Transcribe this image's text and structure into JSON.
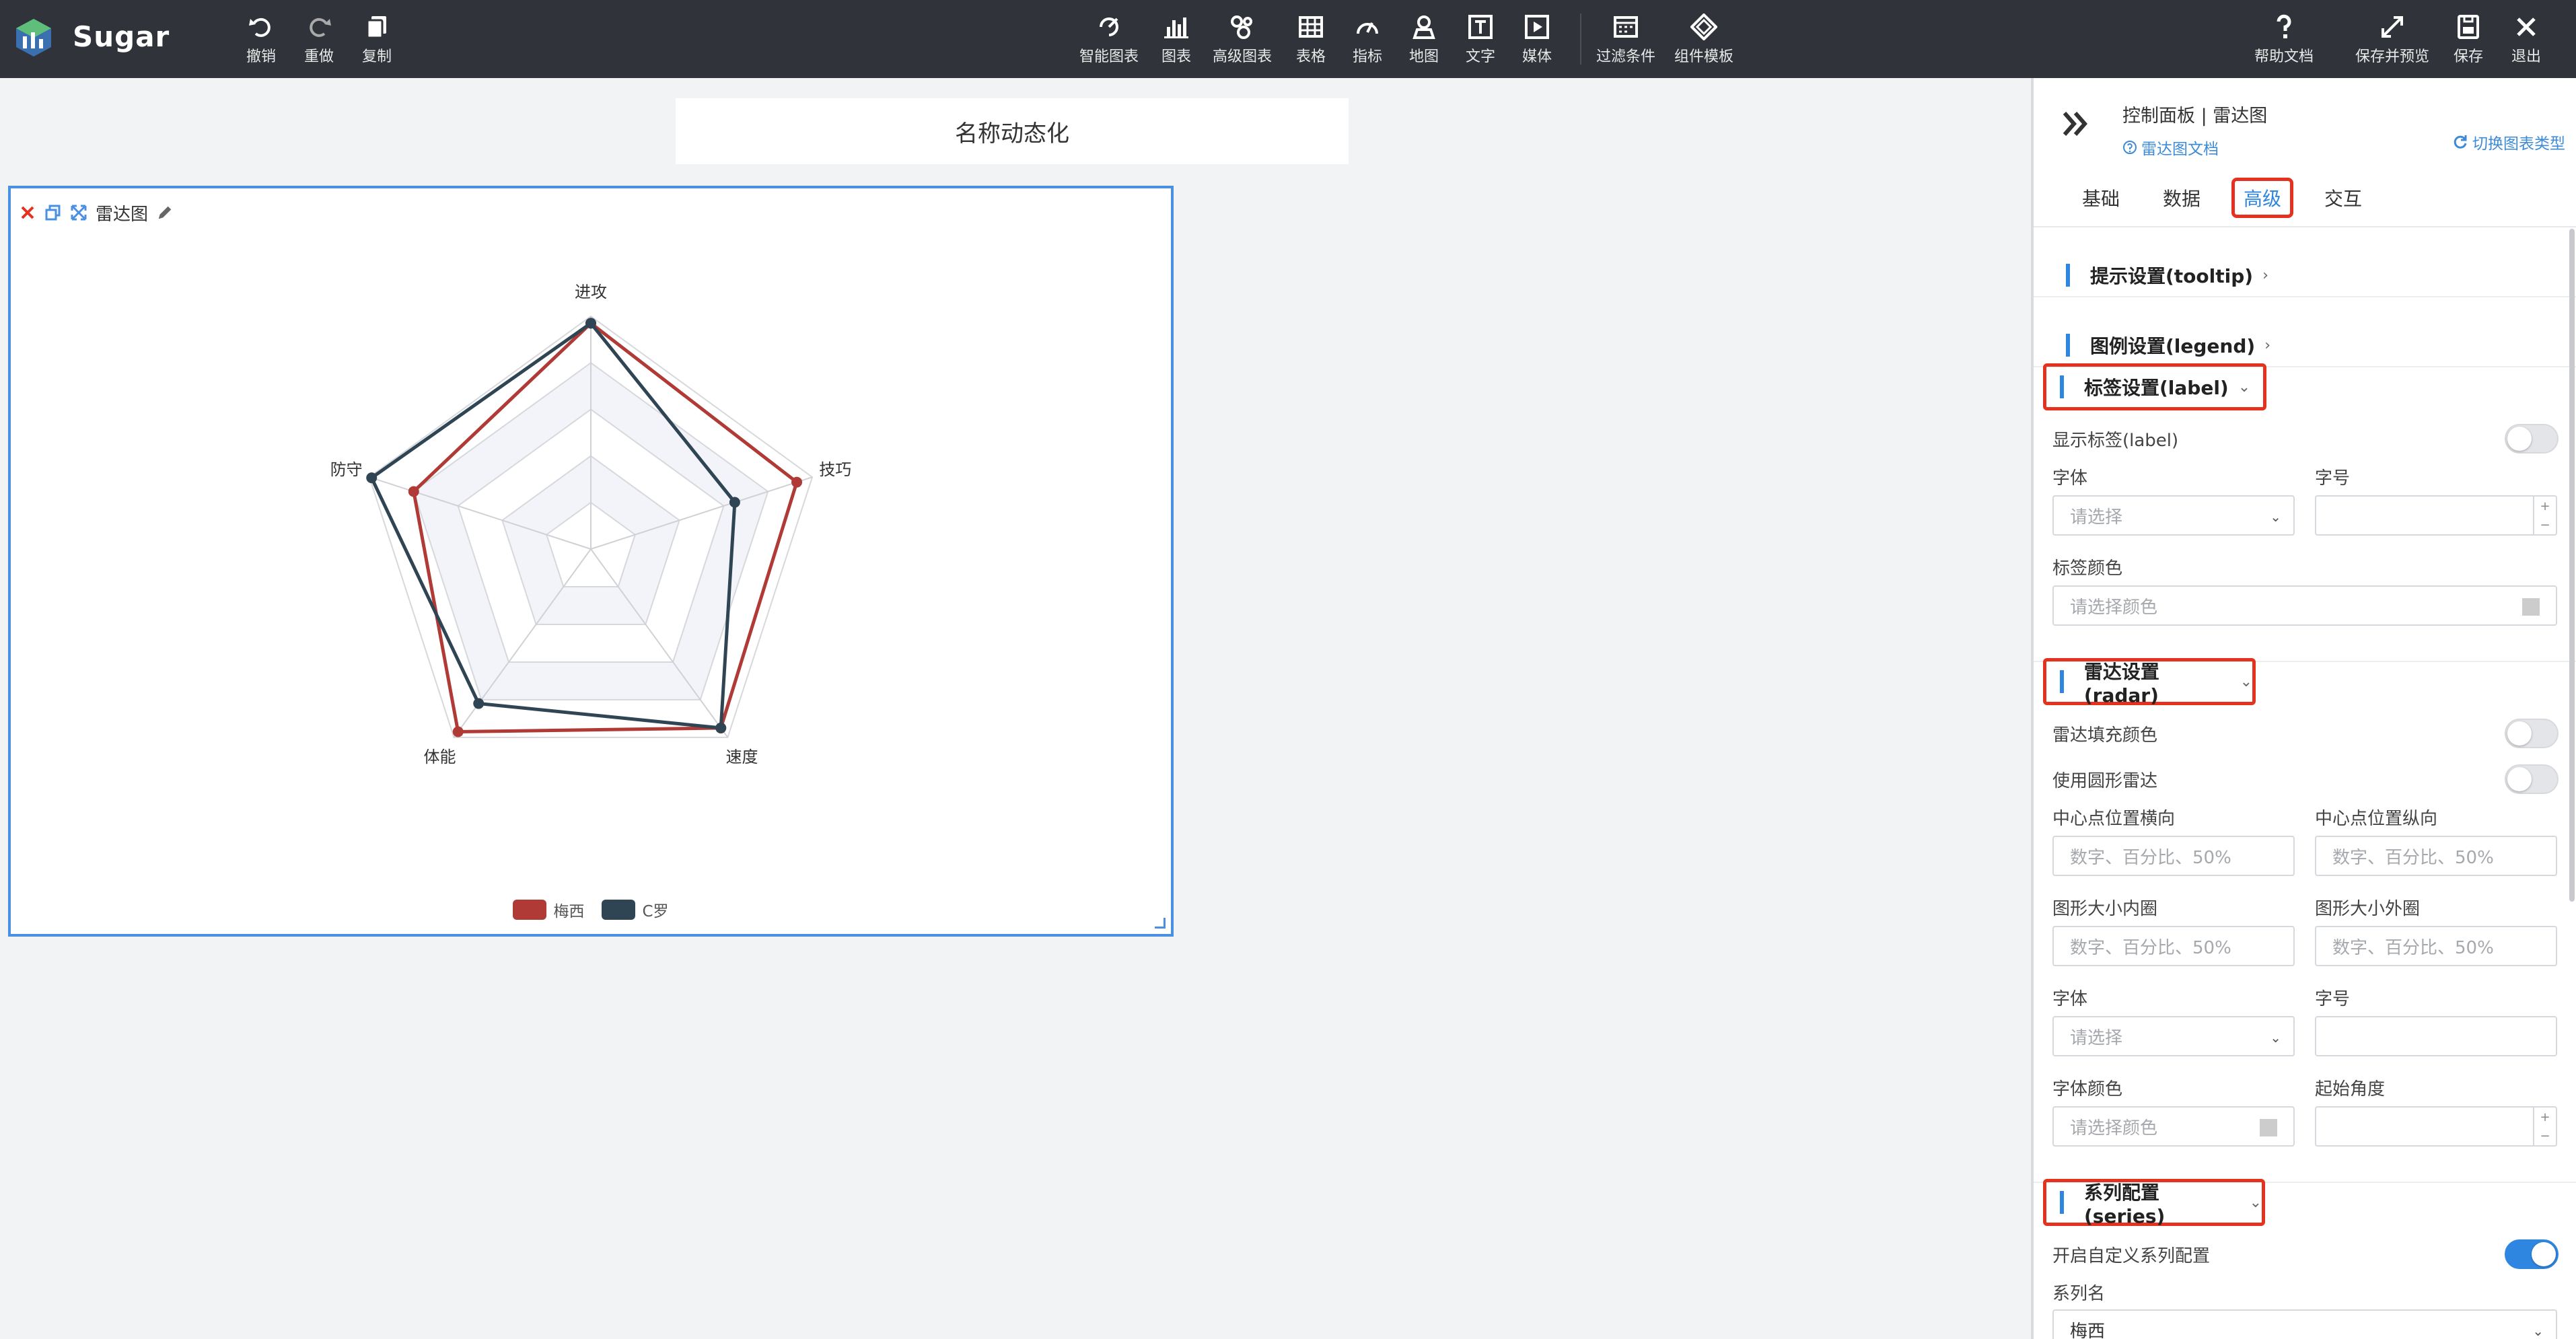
{
  "app": {
    "name": "Sugar"
  },
  "toolbar": {
    "left": [
      {
        "id": "undo",
        "label": "撤销",
        "icon": "undo-icon"
      },
      {
        "id": "redo",
        "label": "重做",
        "icon": "redo-icon"
      },
      {
        "id": "copy",
        "label": "复制",
        "icon": "copy-icon"
      }
    ],
    "center": [
      {
        "id": "smart-chart",
        "label": "智能图表",
        "icon": "smart-chart-icon"
      },
      {
        "id": "chart",
        "label": "图表",
        "icon": "bar-chart-icon"
      },
      {
        "id": "advanced-chart",
        "label": "高级图表",
        "icon": "advanced-chart-icon"
      },
      {
        "id": "table",
        "label": "表格",
        "icon": "table-icon"
      },
      {
        "id": "metric",
        "label": "指标",
        "icon": "gauge-icon"
      },
      {
        "id": "map",
        "label": "地图",
        "icon": "map-icon"
      },
      {
        "id": "text",
        "label": "文字",
        "icon": "text-icon"
      },
      {
        "id": "media",
        "label": "媒体",
        "icon": "media-icon"
      },
      {
        "id": "filter",
        "label": "过滤条件",
        "icon": "filter-icon"
      },
      {
        "id": "template",
        "label": "组件模板",
        "icon": "template-icon"
      }
    ],
    "right": [
      {
        "id": "help",
        "label": "帮助文档",
        "icon": "help-icon"
      },
      {
        "id": "save-preview",
        "label": "保存并预览",
        "icon": "expand-icon"
      },
      {
        "id": "save",
        "label": "保存",
        "icon": "save-icon"
      },
      {
        "id": "exit",
        "label": "退出",
        "icon": "close-icon"
      }
    ]
  },
  "canvas": {
    "title": "名称动态化",
    "card_title": "雷达图"
  },
  "chart_data": {
    "type": "radar",
    "indicators": [
      "进攻",
      "技巧",
      "速度",
      "体能",
      "防守"
    ],
    "max": 100,
    "rings": 5,
    "series": [
      {
        "name": "梅西",
        "color": "#b03a35",
        "values": [
          97,
          93,
          95,
          97,
          80
        ]
      },
      {
        "name": "C罗",
        "color": "#2f4554",
        "values": [
          97,
          65,
          95,
          82,
          99
        ]
      }
    ]
  },
  "panel": {
    "path": "控制面板 | 雷达图",
    "doc_link": "雷达图文档",
    "switch_link": "切换图表类型",
    "tabs": [
      "基础",
      "数据",
      "高级",
      "交互"
    ],
    "active_tab": "高级",
    "sections": {
      "tooltip": "提示设置(tooltip)",
      "legend": "图例设置(legend)",
      "label": "标签设置(label)",
      "radar": "雷达设置(radar)",
      "series": "系列配置(series)"
    },
    "label_section": {
      "show_label": "显示标签(label)",
      "font": "字体",
      "font_placeholder": "请选择",
      "size": "字号",
      "color": "标签颜色",
      "color_placeholder": "请选择颜色"
    },
    "radar_section": {
      "fill_color": "雷达填充颜色",
      "circle": "使用圆形雷达",
      "center_x": "中心点位置横向",
      "center_y": "中心点位置纵向",
      "center_placeholder": "数字、百分比、50%",
      "inner": "图形大小内圈",
      "outer": "图形大小外圈",
      "font": "字体",
      "font_placeholder": "请选择",
      "size": "字号",
      "font_color": "字体颜色",
      "color_placeholder": "请选择颜色",
      "start_angle": "起始角度"
    },
    "series_section": {
      "custom": "开启自定义系列配置",
      "name_label": "系列名",
      "name_value": "梅西"
    }
  },
  "colors": {
    "accent": "#2f86e0",
    "highlight": "#e4321f",
    "topbar": "#30343a"
  }
}
